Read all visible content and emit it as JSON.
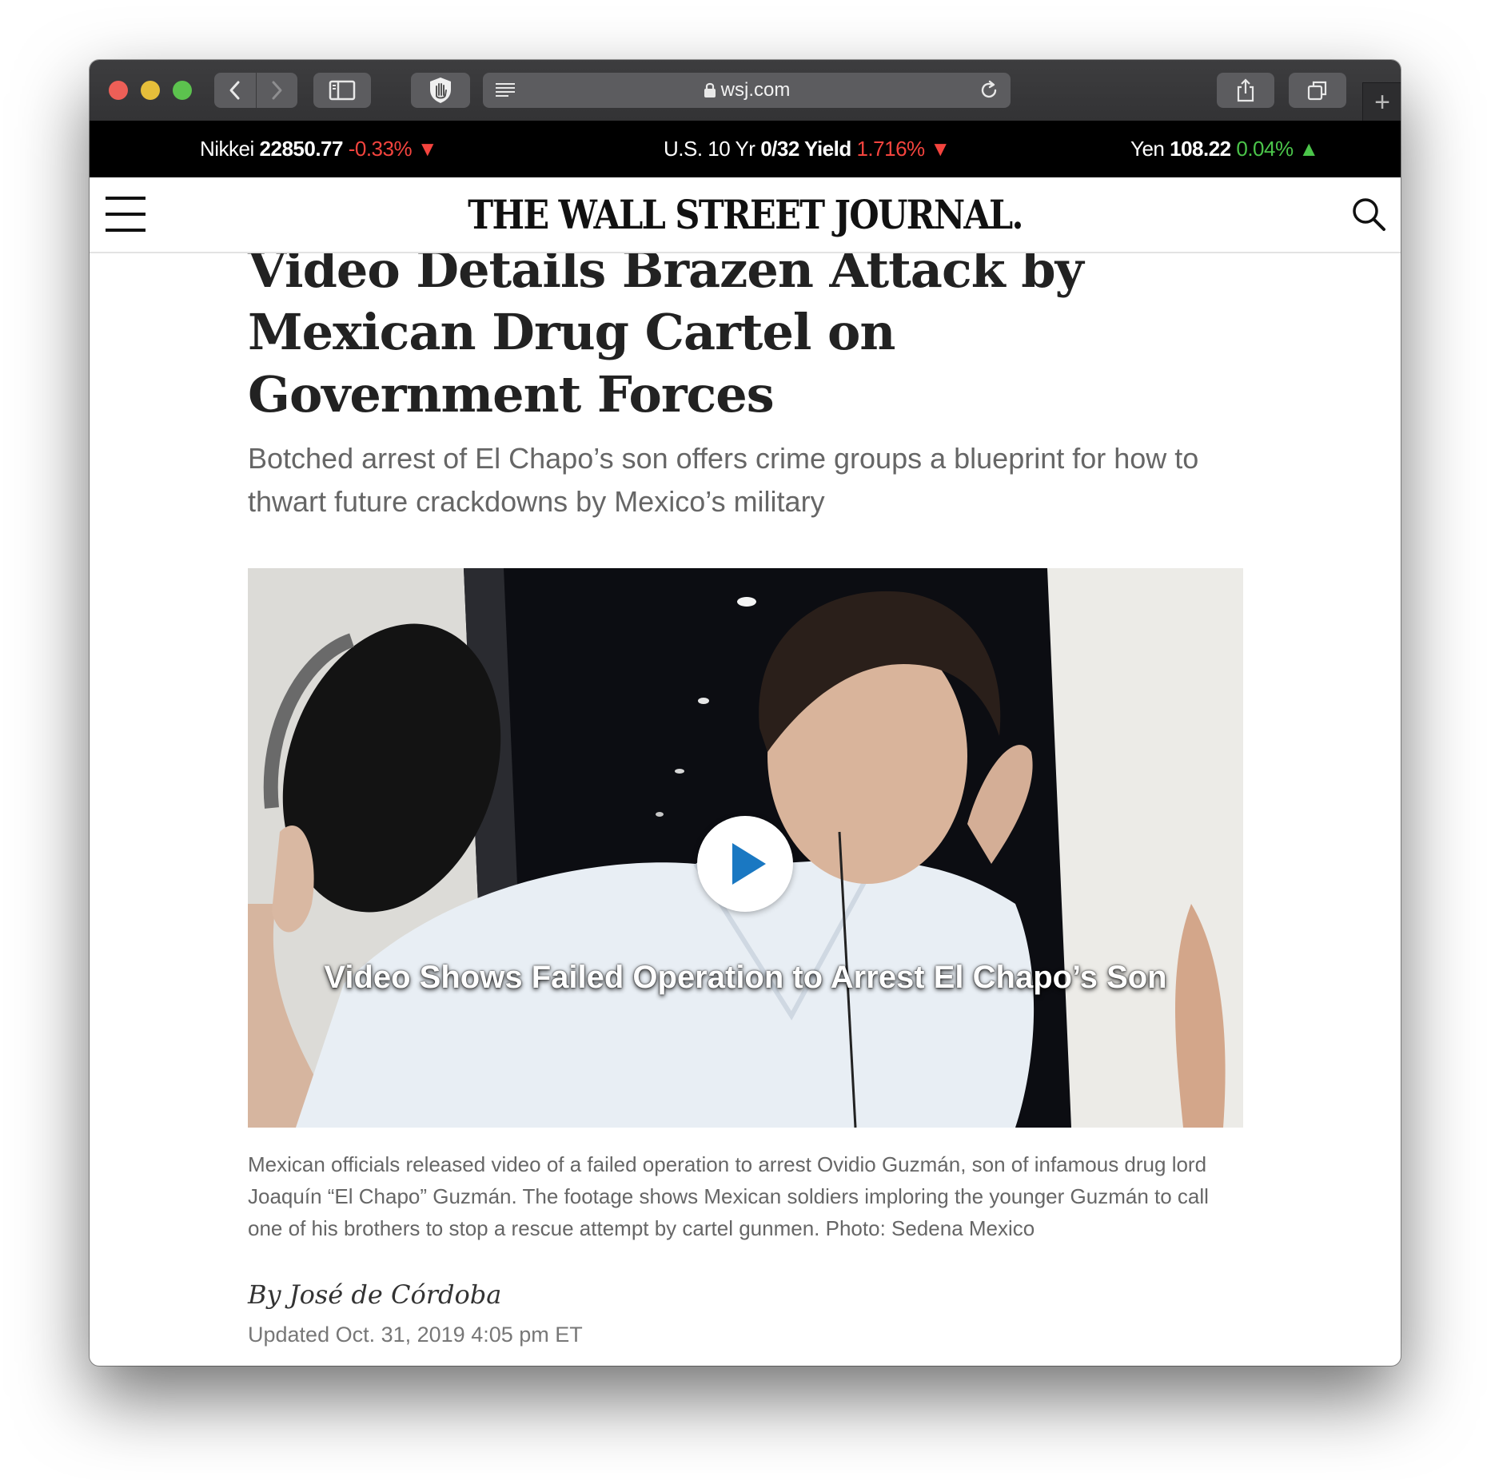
{
  "browser": {
    "url": "wsj.com"
  },
  "ticker": [
    {
      "name": "Nikkei",
      "value": "22850.77",
      "change": "-0.33%",
      "direction": "down"
    },
    {
      "name": "U.S. 10 Yr",
      "value": "0/32 Yield",
      "change": "1.716%",
      "direction": "down"
    },
    {
      "name": "Yen",
      "value": "108.22",
      "change": "0.04%",
      "direction": "up"
    }
  ],
  "masthead": {
    "logo": "THE WALL STREET JOURNAL."
  },
  "article": {
    "headline": "Video Details Brazen Attack by Mexican Drug Cartel on Government Forces",
    "dek": "Botched arrest of El Chapo’s son offers crime groups a blueprint for how to thwart future crackdowns by Mexico’s military",
    "video_title": "Video Shows Failed Operation to Arrest El Chapo’s Son",
    "caption": "Mexican officials released video of a failed operation to arrest Ovidio Guzmán, son of infamous drug lord Joaquín “El Chapo” Guzmán. The footage shows Mexican soldiers imploring the younger Guzmán to call one of his brothers to stop a rescue attempt by cartel gunmen. Photo: Sedena Mexico",
    "byline": "By José de Córdoba",
    "updated": "Updated Oct. 31, 2019 4:05 pm ET"
  },
  "colors": {
    "ticker_negative": "#f4443e",
    "ticker_positive": "#4bc54a",
    "play_icon": "#1a78c2"
  }
}
